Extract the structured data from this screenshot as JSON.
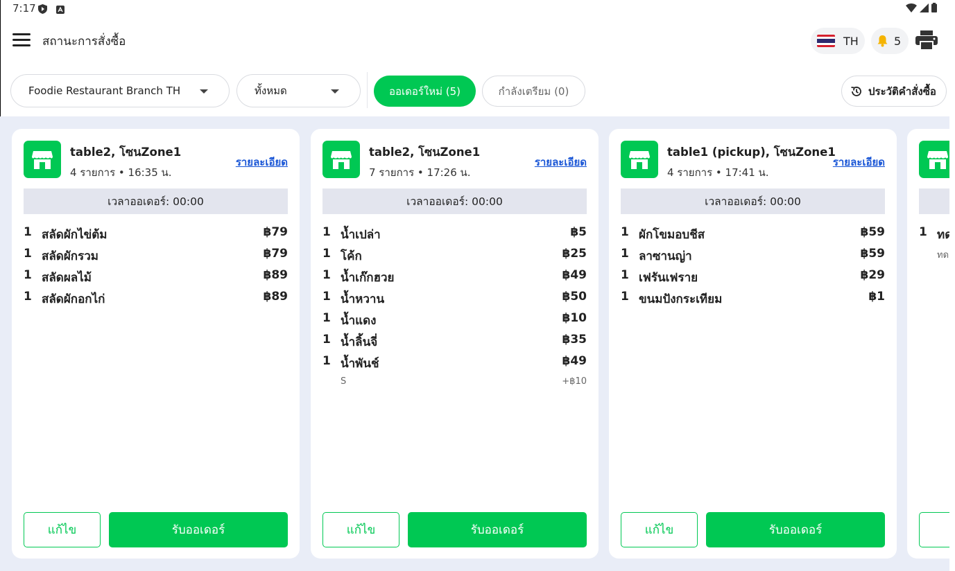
{
  "status_bar": {
    "time": "7:17"
  },
  "header": {
    "title": "สถานะการสั่งซื้อ",
    "language": "TH",
    "notification_count": "5"
  },
  "filters": {
    "branch": "Foodie Restaurant Branch TH",
    "scope": "ทั้งหมด",
    "tab_new": "ออเดอร์ใหม่ (5)",
    "tab_preparing": "กำลังเตรียม (0)",
    "history": "ประวัติคำสั่งซื้อ"
  },
  "colors": {
    "accent": "#00c853",
    "link": "#1a56d6",
    "board_bg": "#e9edf7"
  },
  "orders": [
    {
      "title": "table2, โซนZone1",
      "summary": "4 รายการ • 16:35 น.",
      "detail_label": "รายละเอียด",
      "timer": "เวลาออเดอร์: 00:00",
      "items": [
        {
          "qty": "1",
          "name": "สลัดผักไข่ต้ม",
          "price": "฿79"
        },
        {
          "qty": "1",
          "name": "สลัดผักรวม",
          "price": "฿79"
        },
        {
          "qty": "1",
          "name": "สลัดผลไม้",
          "price": "฿89"
        },
        {
          "qty": "1",
          "name": "สลัดผักอกไก่",
          "price": "฿89"
        }
      ],
      "edit_label": "แก้ไข",
      "accept_label": "รับออเดอร์"
    },
    {
      "title": "table2, โซนZone1",
      "summary": "7 รายการ • 17:26 น.",
      "detail_label": "รายละเอียด",
      "timer": "เวลาออเดอร์: 00:00",
      "items": [
        {
          "qty": "1",
          "name": "น้ำเปล่า",
          "price": "฿5"
        },
        {
          "qty": "1",
          "name": "โค้ก",
          "price": "฿25"
        },
        {
          "qty": "1",
          "name": "น้ำเก๊กฮวย",
          "price": "฿49"
        },
        {
          "qty": "1",
          "name": "น้ำหวาน",
          "price": "฿50"
        },
        {
          "qty": "1",
          "name": "น้ำแดง",
          "price": "฿10"
        },
        {
          "qty": "1",
          "name": "น้ำลิ้นจี่",
          "price": "฿35"
        },
        {
          "qty": "1",
          "name": "น้ำพันช์",
          "price": "฿49"
        }
      ],
      "modifier": {
        "name": "S",
        "price": "+฿10"
      },
      "edit_label": "แก้ไข",
      "accept_label": "รับออเดอร์"
    },
    {
      "title": "table1 (pickup), โซนZone1",
      "summary": "4 รายการ • 17:41 น.",
      "detail_label": "รายละเอียด",
      "timer": "เวลาออเดอร์: 00:00",
      "items": [
        {
          "qty": "1",
          "name": "ผักโขมอบชีส",
          "price": "฿59"
        },
        {
          "qty": "1",
          "name": "ลาซานญ่า",
          "price": "฿59"
        },
        {
          "qty": "1",
          "name": "เฟรันเฟราย",
          "price": "฿29"
        },
        {
          "qty": "1",
          "name": "ขนมปังกระเทียม",
          "price": "฿1"
        }
      ],
      "edit_label": "แก้ไข",
      "accept_label": "รับออเดอร์"
    },
    {
      "items": [
        {
          "qty": "1",
          "name": "ทด",
          "price": ""
        }
      ],
      "modifier": {
        "name": "ทด",
        "price": ""
      },
      "edit_label": "แ"
    }
  ]
}
